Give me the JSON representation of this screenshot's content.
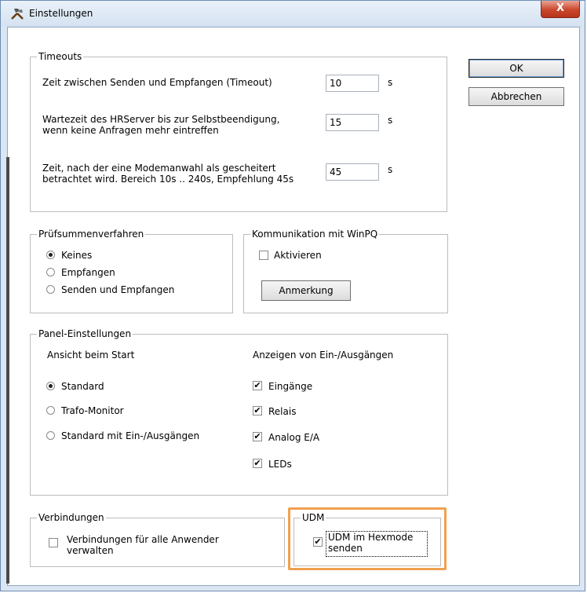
{
  "window": {
    "title": "Einstellungen",
    "close_label": "X"
  },
  "buttons": {
    "ok": "OK",
    "cancel": "Abbrechen"
  },
  "timeouts": {
    "title": "Timeouts",
    "rows": [
      {
        "label": "Zeit zwischen Senden und Empfangen (Timeout)",
        "value": "10",
        "unit": "s"
      },
      {
        "label": "Wartezeit des HRServer bis zur Selbstbeendigung, wenn keine Anfragen mehr eintreffen",
        "value": "15",
        "unit": "s"
      },
      {
        "label": "Zeit, nach der eine Modemanwahl als gescheitert betrachtet wird. Bereich 10s .. 240s, Empfehlung 45s",
        "value": "45",
        "unit": "s"
      }
    ]
  },
  "checksum": {
    "title": "Prüfsummenverfahren",
    "options": [
      "Keines",
      "Empfangen",
      "Senden und Empfangen"
    ],
    "selected": "Keines"
  },
  "winpq": {
    "title": "Kommunikation mit WinPQ",
    "activate_label": "Aktivieren",
    "activate_checked": false,
    "note_button": "Anmerkung"
  },
  "panel": {
    "title": "Panel-Einstellungen",
    "start_view_title": "Ansicht beim Start",
    "start_options": [
      "Standard",
      "Trafo-Monitor",
      "Standard mit Ein-/Ausgängen"
    ],
    "start_selected": "Standard",
    "io_title": "Anzeigen von Ein-/Ausgängen",
    "io_options": [
      {
        "label": "Eingänge",
        "checked": true
      },
      {
        "label": "Relais",
        "checked": true
      },
      {
        "label": "Analog E/A",
        "checked": true
      },
      {
        "label": "LEDs",
        "checked": true
      }
    ]
  },
  "connections": {
    "title": "Verbindungen",
    "manage_label": "Verbindungen für alle Anwender verwalten",
    "manage_checked": false
  },
  "udm": {
    "title": "UDM",
    "hexmode_label": "UDM im Hexmode senden",
    "hexmode_checked": true
  },
  "colors": {
    "highlight": "#f0a050",
    "close_button": "#c9462c"
  },
  "icons": {
    "title_icon": "tools-icon"
  }
}
